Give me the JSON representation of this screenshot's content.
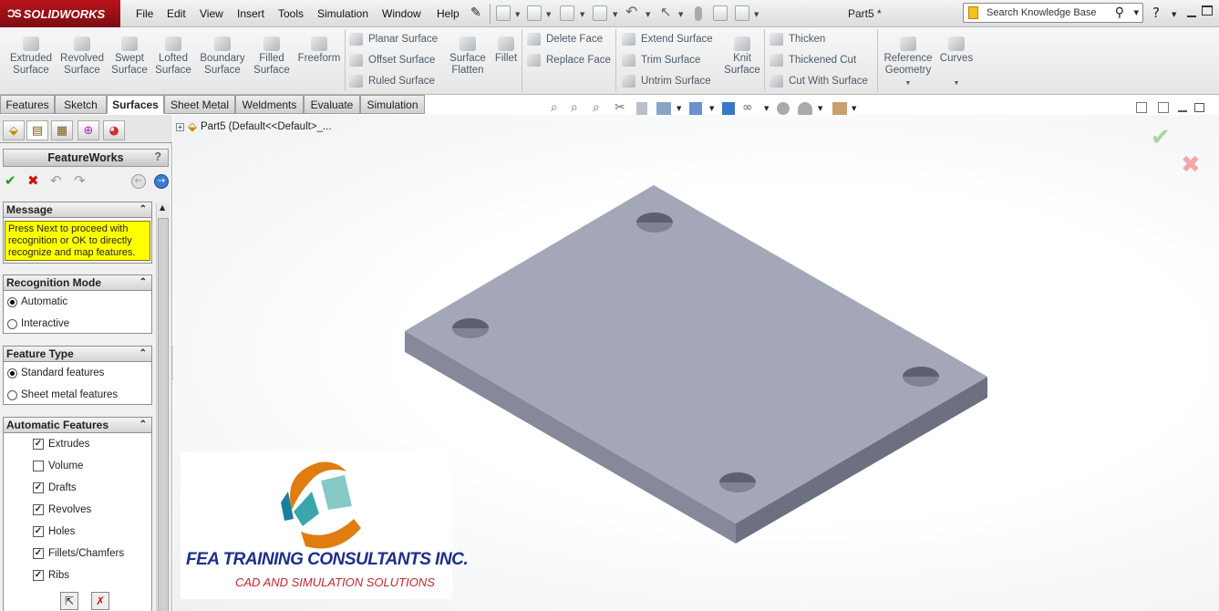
{
  "app": {
    "brand": "SOLIDWORKS",
    "doc_title": "Part5 *"
  },
  "menu": [
    "File",
    "Edit",
    "View",
    "Insert",
    "Tools",
    "Simulation",
    "Window",
    "Help"
  ],
  "search": {
    "placeholder": "Search Knowledge Base"
  },
  "ribbon": {
    "big_buttons": [
      {
        "l1": "Extruded",
        "l2": "Surface"
      },
      {
        "l1": "Revolved",
        "l2": "Surface"
      },
      {
        "l1": "Swept",
        "l2": "Surface"
      },
      {
        "l1": "Lofted",
        "l2": "Surface"
      },
      {
        "l1": "Boundary",
        "l2": "Surface"
      },
      {
        "l1": "Filled",
        "l2": "Surface"
      },
      {
        "l1": "Freeform",
        "l2": ""
      }
    ],
    "group2": [
      "Planar Surface",
      "Offset Surface",
      "Ruled Surface"
    ],
    "flatten": {
      "l1": "Surface",
      "l2": "Flatten"
    },
    "fillet": "Fillet",
    "group3": [
      "Delete Face",
      "Replace Face"
    ],
    "group4": [
      "Extend Surface",
      "Trim Surface",
      "Untrim Surface"
    ],
    "knit": {
      "l1": "Knit",
      "l2": "Surface"
    },
    "group5": [
      "Thicken",
      "Thickened Cut",
      "Cut With Surface"
    ],
    "refgeo": {
      "l1": "Reference",
      "l2": "Geometry"
    },
    "curves": "Curves"
  },
  "tabs": [
    "Features",
    "Sketch",
    "Surfaces",
    "Sheet Metal",
    "Weldments",
    "Evaluate",
    "Simulation"
  ],
  "panel": {
    "title": "FeatureWorks",
    "help": "?",
    "message": {
      "header": "Message",
      "lines": [
        "Press Next to proceed with",
        "recognition or OK to directly",
        "recognize and map features."
      ]
    },
    "recognition_mode": {
      "header": "Recognition Mode",
      "options": [
        "Automatic",
        "Interactive"
      ],
      "selected": "Automatic"
    },
    "feature_type": {
      "header": "Feature Type",
      "options": [
        "Standard features",
        "Sheet metal features"
      ],
      "selected": "Standard features"
    },
    "auto_features": {
      "header": "Automatic Features",
      "items": [
        {
          "label": "Extrudes",
          "checked": true
        },
        {
          "label": "Volume",
          "checked": false
        },
        {
          "label": "Drafts",
          "checked": true
        },
        {
          "label": "Revolves",
          "checked": true
        },
        {
          "label": "Holes",
          "checked": true
        },
        {
          "label": "Fillets/Chamfers",
          "checked": true
        },
        {
          "label": "Ribs",
          "checked": true
        }
      ]
    }
  },
  "tree": {
    "label": "Part5  (Default<<Default>_..."
  },
  "watermark": {
    "line1": "FEA TRAINING  CONSULTANTS  INC.",
    "line2": "CAD AND SIMULATION SOLUTIONS"
  },
  "colors": {
    "accent": "#b8131b",
    "message_bg": "#ffff00",
    "part_top": "#a4a8b9",
    "part_front": "#8a8ea0",
    "part_side": "#6f7383",
    "logo_orange": "#e07d10",
    "logo_teal": "#3aa6ac",
    "logo_text": "#1d2f87",
    "logo_sub": "#c0282e"
  }
}
